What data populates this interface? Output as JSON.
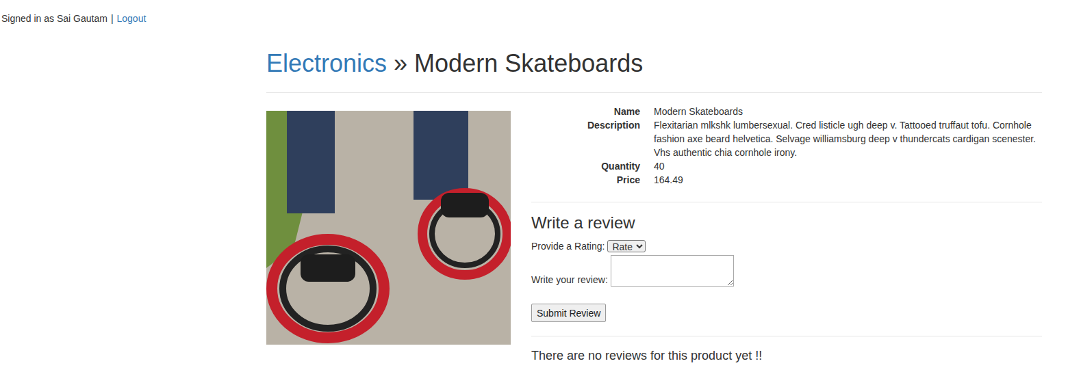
{
  "session": {
    "signed_in_text": "Signed in as Sai Gautam",
    "separator": "|",
    "logout": "Logout"
  },
  "breadcrumb": {
    "category": "Electronics",
    "separator": "»",
    "current": "Modern Skateboards"
  },
  "product": {
    "fields": [
      {
        "label": "Name",
        "value": "Modern Skateboards"
      },
      {
        "label": "Description",
        "value": "Flexitarian mlkshk lumbersexual. Cred listicle ugh deep v. Tattooed truffaut tofu. Cornhole fashion axe beard helvetica. Selvage williamsburg deep v thundercats cardigan scenester. Vhs authentic chia cornhole irony."
      },
      {
        "label": "Quantity",
        "value": "40"
      },
      {
        "label": "Price",
        "value": "164.49"
      }
    ]
  },
  "review_form": {
    "title": "Write a review",
    "rating_label": "Provide a Rating:",
    "rating_value": "Rate",
    "review_label": "Write your review:",
    "submit": "Submit Review"
  },
  "reviews": {
    "empty_text": "There are no reviews for this product yet !!"
  }
}
